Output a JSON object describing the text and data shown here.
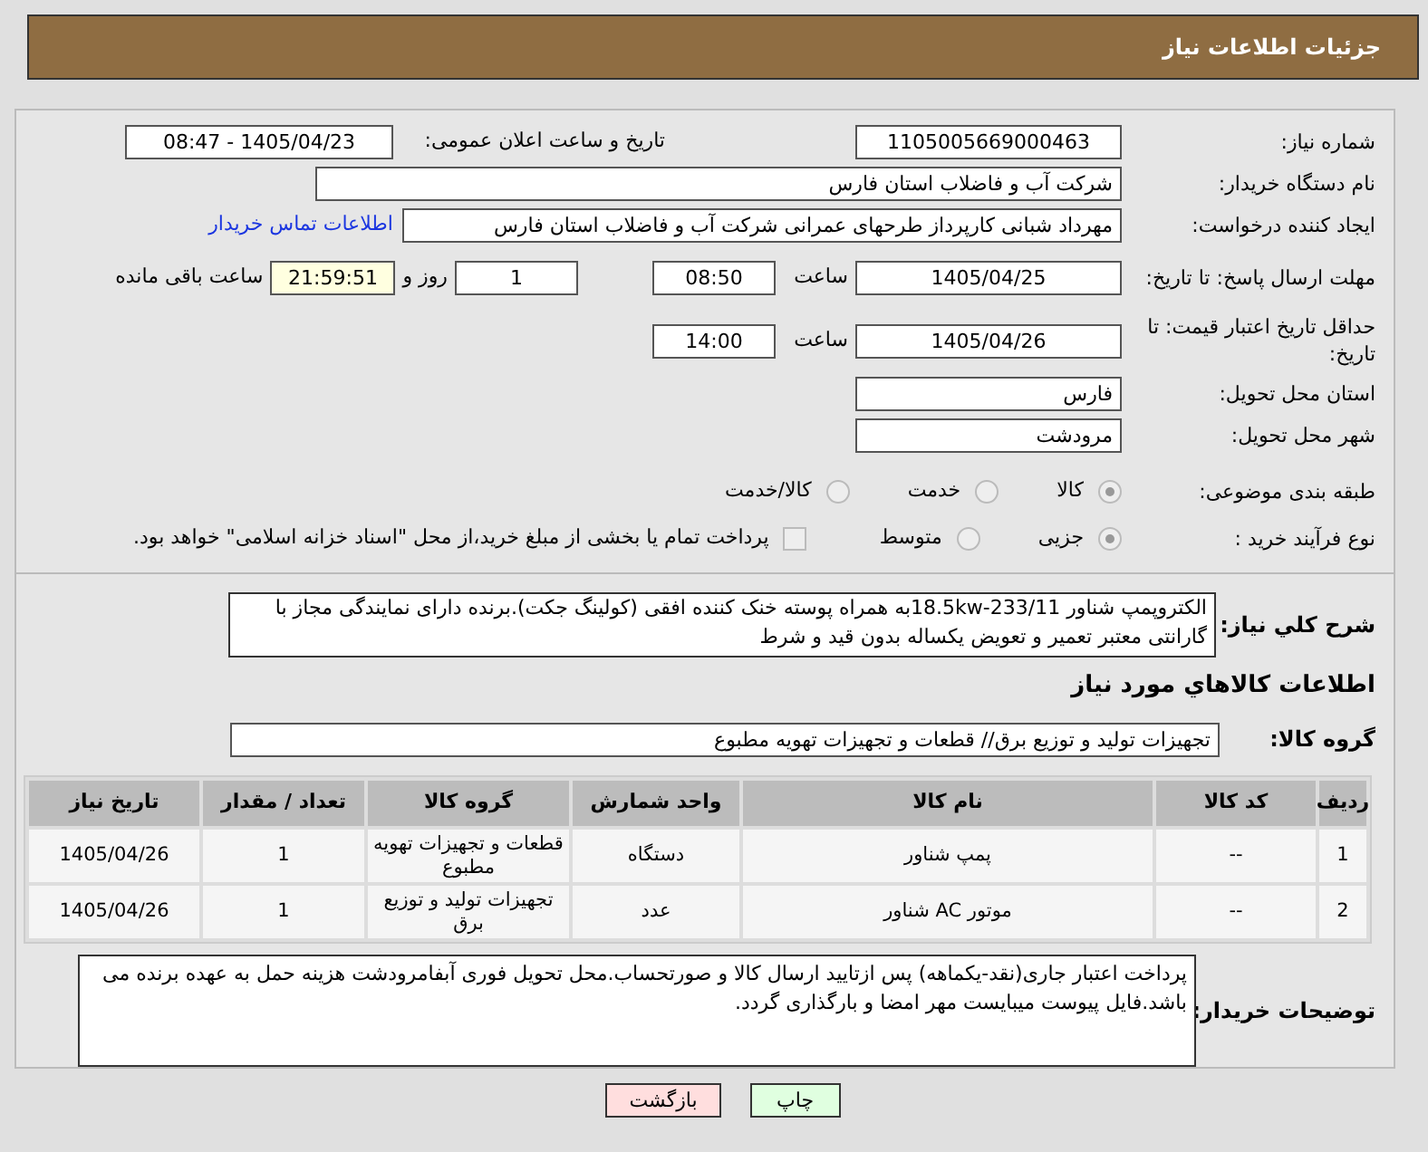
{
  "header": {
    "title": "جزئیات اطلاعات نیاز"
  },
  "need_number": {
    "label": "شماره نیاز:",
    "value": "1105005669000463"
  },
  "announce": {
    "label": "تاریخ و ساعت اعلان عمومی:",
    "value": "1405/04/23 - 08:47"
  },
  "buyer": {
    "label": "نام دستگاه خریدار:",
    "value": "شرکت آب و فاضلاب استان فارس"
  },
  "creator": {
    "label": "ایجاد کننده درخواست:",
    "value": "مهرداد شبانی کارپرداز طرحهای عمرانی  شرکت آب و فاضلاب استان فارس",
    "link": "اطلاعات تماس خریدار"
  },
  "deadline": {
    "label": "مهلت ارسال پاسخ: تا تاریخ:",
    "date": "1405/04/25",
    "time_label": "ساعت",
    "time": "08:50",
    "days": "1",
    "days_label": "روز و",
    "remaining": "21:59:51",
    "remaining_label": "ساعت باقی مانده"
  },
  "validity": {
    "label": "حداقل تاریخ اعتبار قیمت: تا تاریخ:",
    "date": "1405/04/26",
    "time_label": "ساعت",
    "time": "14:00"
  },
  "province": {
    "label": "استان محل تحویل:",
    "value": "فارس"
  },
  "city": {
    "label": "شهر محل تحویل:",
    "value": "مرودشت"
  },
  "category": {
    "label": "طبقه بندی موضوعی:",
    "options": [
      {
        "label": "کالا",
        "selected": true
      },
      {
        "label": "خدمت",
        "selected": false
      },
      {
        "label": "کالا/خدمت",
        "selected": false
      }
    ]
  },
  "process": {
    "label": "نوع فرآیند خرید :",
    "options": [
      {
        "label": "جزیی",
        "selected": true
      },
      {
        "label": "متوسط",
        "selected": false
      }
    ],
    "treasury": {
      "label": "پرداخت تمام یا بخشی از مبلغ خرید،از محل \"اسناد خزانه اسلامی\" خواهد بود.",
      "checked": false
    }
  },
  "description": {
    "label": "شرح کلي نياز:",
    "value": "الکتروپمپ شناور 18.5kw-233/11به همراه پوسته خنک کننده افقی (کولینگ جکت).برنده دارای نمایندگی مجاز با گارانتی معتبر تعمیر و تعویض یکساله بدون قید و شرط"
  },
  "goods_heading": "اطلاعات کالاهاي مورد نياز",
  "goods_group": {
    "label": "گروه کالا:",
    "value": "تجهیزات تولید و توزیع برق//  قطعات و تجهیزات تهویه مطبوع"
  },
  "table": {
    "columns": [
      "ردیف",
      "کد کالا",
      "نام کالا",
      "واحد شمارش",
      "گروه کالا",
      "تعداد / مقدار",
      "تاریخ نیاز"
    ],
    "rows": [
      [
        "1",
        "--",
        "پمپ شناور",
        "دستگاه",
        "قطعات و تجهیزات تهویه مطبوع",
        "1",
        "1405/04/26"
      ],
      [
        "2",
        "--",
        "موتور AC شناور",
        "عدد",
        "تجهیزات تولید و توزیع برق",
        "1",
        "1405/04/26"
      ]
    ]
  },
  "buyer_notes": {
    "label": "توضیحات خریدار:",
    "value": "پرداخت اعتبار جاری(نقد-یکماهه) پس ازتایید ارسال کالا و صورتحساب.محل تحویل فوری آبفامرودشت هزینه حمل به عهده برنده می باشد.فایل پیوست میبایست مهر امضا و بارگذاری گردد."
  },
  "buttons": [
    {
      "label": "چاپ",
      "kind": "print"
    },
    {
      "label": "بازگشت",
      "kind": "back"
    }
  ]
}
